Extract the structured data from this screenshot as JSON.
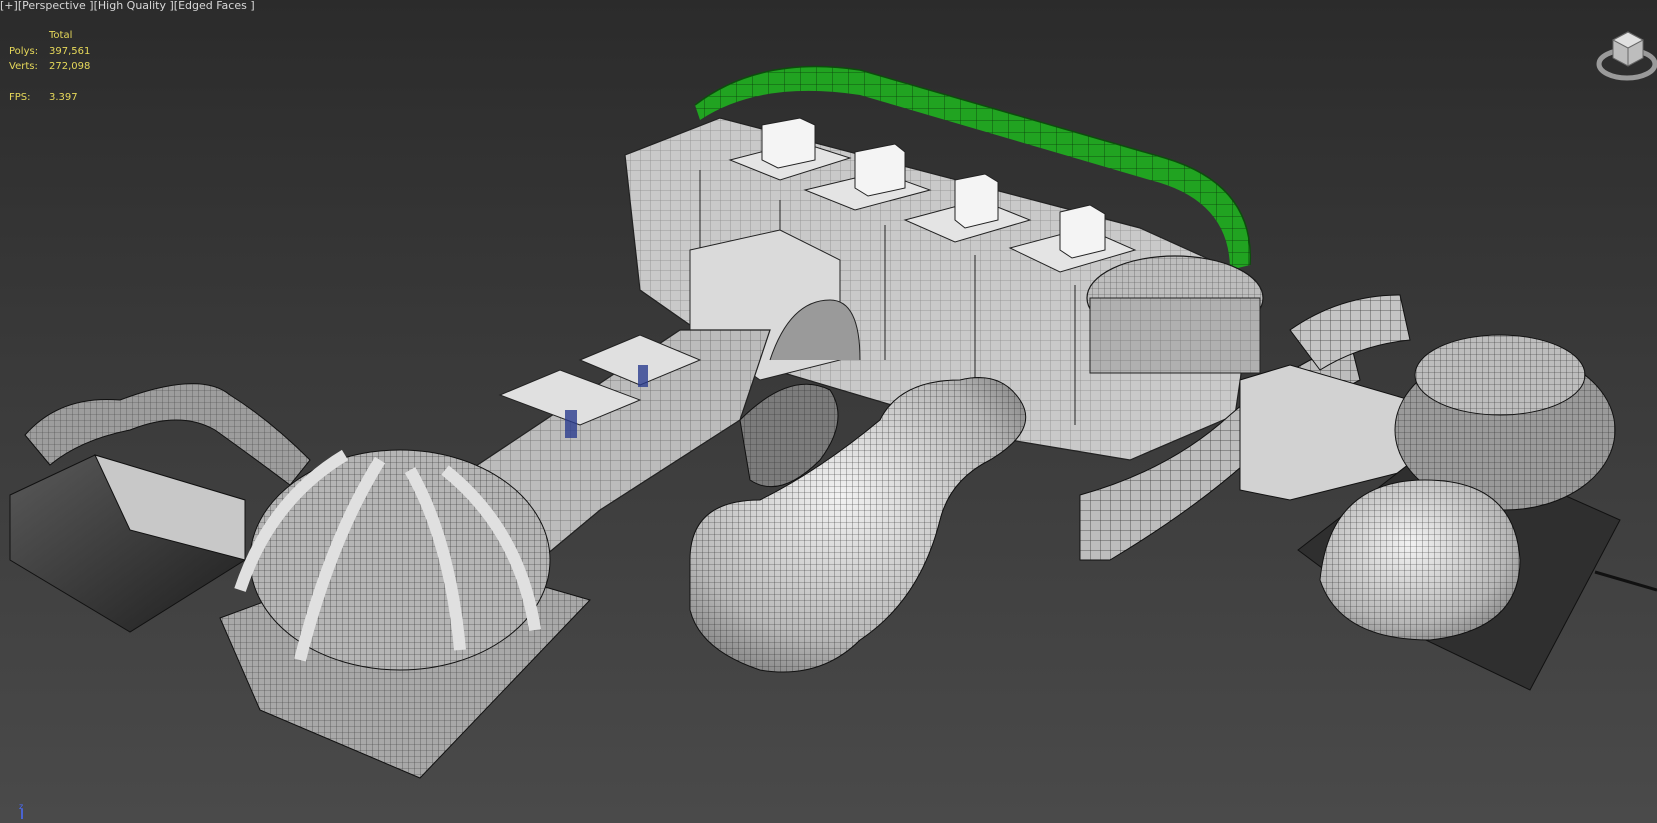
{
  "viewport": {
    "label": {
      "plus": "[+]",
      "view": "[Perspective ]",
      "shading": "[High Quality ]",
      "edges": "[Edged Faces ]"
    },
    "stats": {
      "header": "Total",
      "polys_label": "Polys:",
      "polys_value": "397,561",
      "verts_label": "Verts:",
      "verts_value": "272,098",
      "fps_label": "FPS:",
      "fps_value": "3.397"
    },
    "axis_label": "z"
  },
  "colors": {
    "background_top": "#2b2b2b",
    "background_bottom": "#4a4a4a",
    "stats_text": "#e6d85a",
    "selection_green": "#21a321",
    "geometry_light": "#d6d6d6",
    "wire": "#1a1a1a"
  },
  "icons": {
    "viewcube": "viewcube-icon",
    "axis": "axis-tripod-icon"
  }
}
